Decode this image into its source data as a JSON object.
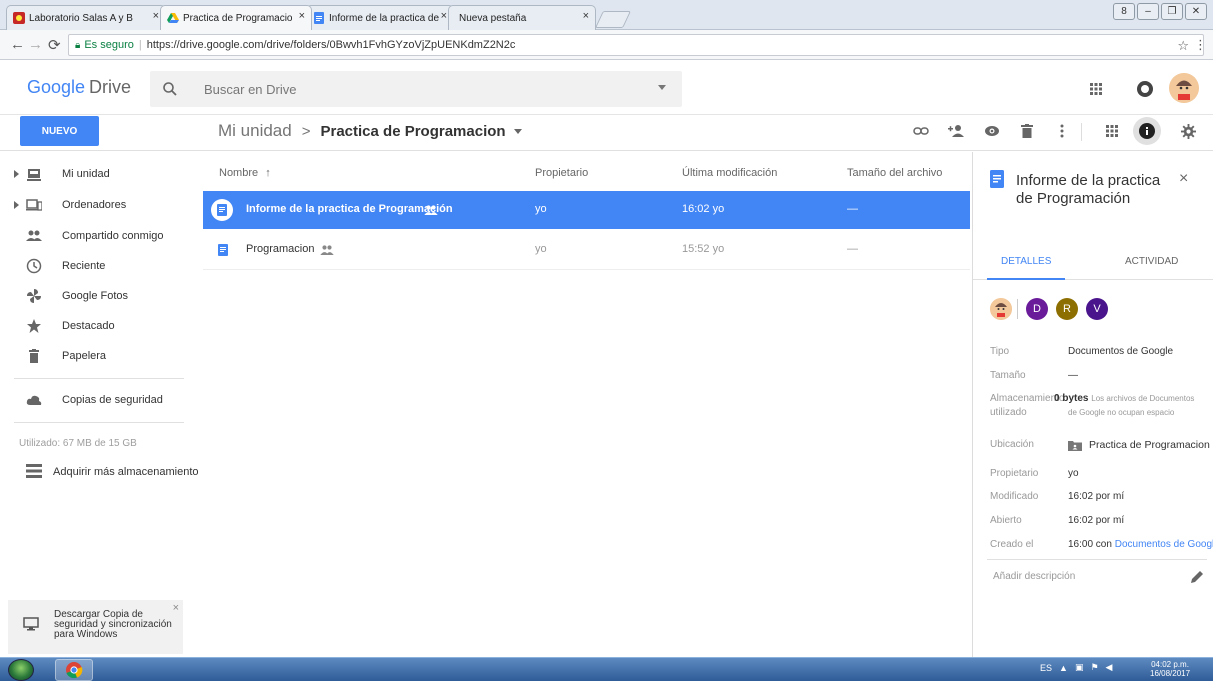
{
  "browser": {
    "tabs": [
      {
        "label": "Laboratorio Salas A y B"
      },
      {
        "label": "Practica de Programacio"
      },
      {
        "label": "Informe de la practica de"
      },
      {
        "label": "Nueva pestaña"
      }
    ],
    "close_glyph": "×",
    "secure_label": "Es seguro",
    "url": "https://drive.google.com/drive/folders/0Bwvh1FvhGYzoVjZpUENKdmZ2N2c"
  },
  "header": {
    "logo_google": "Google",
    "logo_drive": "Drive",
    "search_placeholder": "Buscar en Drive"
  },
  "toolbar": {
    "new_label": "NUEVO",
    "breadcrumb_root": "Mi unidad",
    "breadcrumb_sep": ">",
    "breadcrumb_current": "Practica de Programacion"
  },
  "sidebar": {
    "items": [
      {
        "label": "Mi unidad",
        "icon": "drive-icon"
      },
      {
        "label": "Ordenadores",
        "icon": "computer-icon"
      },
      {
        "label": "Compartido conmigo",
        "icon": "people-icon"
      },
      {
        "label": "Reciente",
        "icon": "clock-icon"
      },
      {
        "label": "Google Fotos",
        "icon": "pinwheel-icon"
      },
      {
        "label": "Destacado",
        "icon": "star-icon"
      },
      {
        "label": "Papelera",
        "icon": "trash-icon"
      }
    ],
    "backup_label": "Copias de seguridad",
    "storage_text": "Utilizado: 67 MB de 15 GB",
    "buy_storage_label": "Adquirir más almacenamiento",
    "promo_text": "Descargar Copia de seguridad y sincronización para Windows"
  },
  "files": {
    "columns": {
      "name": "Nombre",
      "sort_glyph": "↑",
      "owner": "Propietario",
      "modified": "Última modificación",
      "size": "Tamaño del archivo"
    },
    "rows": [
      {
        "name": "Informe de la practica de Programación",
        "owner": "yo",
        "modified": "16:02 yo",
        "size": "—",
        "selected": true
      },
      {
        "name": "Programacion",
        "owner": "yo",
        "modified": "15:52 yo",
        "size": "—",
        "selected": false
      }
    ]
  },
  "details": {
    "title": "Informe de la practica de Programación",
    "tab_details": "DETALLES",
    "tab_activity": "ACTIVIDAD",
    "sharers": [
      {
        "initial": "D",
        "color": "#6a1b9a"
      },
      {
        "initial": "R",
        "color": "#8d6e00"
      },
      {
        "initial": "V",
        "color": "#4a148c"
      }
    ],
    "props": {
      "type_label": "Tipo",
      "type_value": "Documentos de Google",
      "size_label": "Tamaño",
      "size_value": "—",
      "storage_label_1": "Almacenamiento",
      "storage_label_2": "utilizado",
      "storage_value": "0 bytes",
      "storage_note_1": "Los archivos de Documentos",
      "storage_note_2": "de Google no ocupan espacio",
      "location_label": "Ubicación",
      "location_value": "Practica de Programacion",
      "owner_label": "Propietario",
      "owner_value": "yo",
      "modified_label": "Modificado",
      "modified_value": "16:02 por mí",
      "opened_label": "Abierto",
      "opened_value": "16:02 por mí",
      "created_label": "Creado el",
      "created_value": "16:00 con",
      "created_app": "Documentos de Google"
    },
    "description_placeholder": "Añadir descripción"
  },
  "taskbar": {
    "lang": "ES",
    "time": "04:02 p.m.",
    "date": "16/08/2017"
  },
  "colors": {
    "accent": "#4285f4",
    "selection": "#4285f4"
  }
}
